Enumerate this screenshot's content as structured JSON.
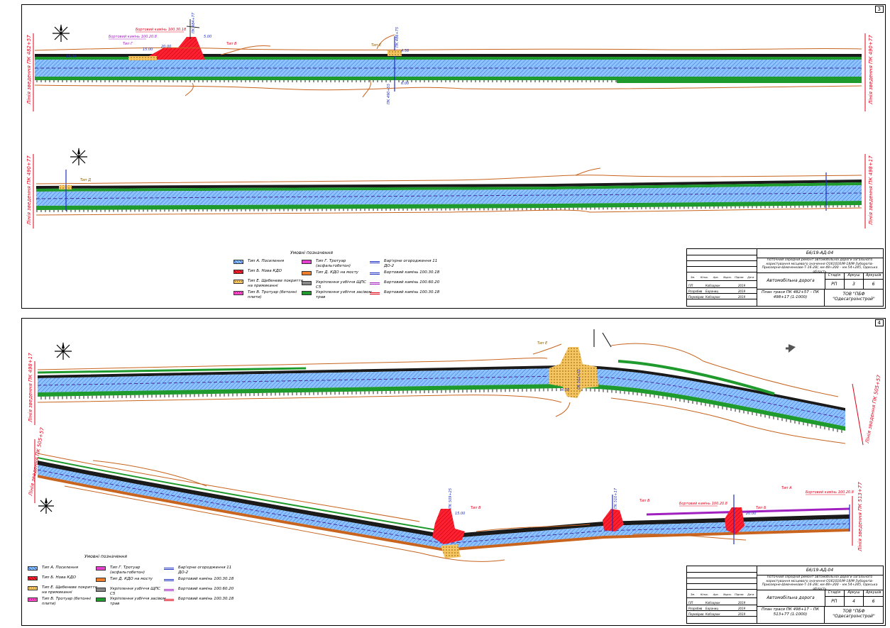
{
  "sheets": [
    {
      "sheet_no": "3",
      "match_lines": [
        "Лінія зведення ПК 482+57",
        "Лінія зведення ПК 490+77",
        "Лінія зведення ПК 490+77",
        "Лінія зведення ПК 498+17"
      ],
      "callouts": [
        "Бортовий камінь 100.30.18",
        "Бортовий камінь 100.20.8",
        "Тип Г",
        "Тип В",
        "Тип Е",
        "Тип Д",
        "15.00",
        "20.00",
        "5.00",
        "4.58",
        "15.00",
        "6.00",
        "ПК 484+77",
        "ПК 486+75",
        "ПК 490+55"
      ],
      "legend": {
        "title": "Умовні позначення",
        "items": [
          {
            "label": "Тип А. Посилення",
            "color": "#5aa9ff",
            "kind": "hatch"
          },
          {
            "label": "Тип Б. Нова КДО",
            "color": "#e0001a",
            "kind": "hatch"
          },
          {
            "label": "Тип Е. Щебеневе покриття на примиканні",
            "color": "#f0b441",
            "kind": "dots"
          },
          {
            "label": "Тип В. Тротуар (бетонні плити)",
            "color": "#ff48c8",
            "kind": "dots"
          },
          {
            "label": "Тип Г. Тротуар (асфальтобетон)",
            "color": "#e63fd0",
            "kind": "solid"
          },
          {
            "label": "Тип Д. КДО на мосту",
            "color": "#f07d2a",
            "kind": "solid"
          },
          {
            "label": "Укріплення узбіччя ЩПС С5",
            "color": "#888888",
            "kind": "solid"
          },
          {
            "label": "Укріплення узбіччя засівом трав",
            "color": "#1f9a2c",
            "kind": "solid"
          },
          {
            "label": "Бар'єрне огородження 11 ДО-2",
            "color": "#1e2fc4",
            "kind": "barrier"
          },
          {
            "label": "Бортовий камінь 100.30.18",
            "color": "#1e2fc4",
            "kind": "line"
          },
          {
            "label": "Бортовий камінь 100.60.20",
            "color": "#a020c0",
            "kind": "line"
          },
          {
            "label": "Бортовий камінь 100.30.18",
            "color": "#e0001a",
            "kind": "line"
          }
        ]
      },
      "title_block": {
        "code": "Б6/19-АД-04",
        "description": "Поточний середній ремонт автомобільної дороги загального користування місцевого значення О161016/М-18/М-Зуборогів-Приозерне-Шевченкове-Т-16-28/, км 48+200 – км 54+245, Одеська область",
        "object": "Автомобільна дорога",
        "stage_label": "Стадія",
        "sheet_label": "Аркуш",
        "sheets_label": "Аркушів",
        "stage": "РП",
        "sheet": "3",
        "sheets": "6",
        "plan": "План траси ПК 482+57 – ПК 498+17 (1:1000)",
        "org": "ТОВ \"ПБФ \"Одесагроінстрой\"",
        "header_cols": [
          "Зм.",
          "Кільк.",
          "Арк.",
          "№док.",
          "Підпис",
          "Дата"
        ],
        "rows": [
          {
            "role": "ГІП",
            "name": "Кобзарюк",
            "date": "2019"
          },
          {
            "role": "Розробив",
            "name": "Бараниц",
            "date": "2019"
          },
          {
            "role": "Перевірив",
            "name": "Кобзарюк",
            "date": "2019"
          }
        ]
      }
    },
    {
      "sheet_no": "4",
      "match_lines": [
        "Лінія зведення ПК 498+17",
        "Лінія зведення ПК 505+57",
        "Лінія зведення ПК 505+57",
        "Лінія зведення ПК 513+77"
      ],
      "callouts": [
        "Бортовий камінь 100.20.8",
        "Бортовий камінь 100.20.8",
        "Тип Е",
        "Тип В",
        "Тип В",
        "Тип Б",
        "Тип А",
        "4.58",
        "15.00",
        "20.00",
        "ПК 502+55",
        "ПК 509+25",
        "ПК 510+17"
      ],
      "legend": {
        "title": "Умовні позначення",
        "items": [
          {
            "label": "Тип А. Посилення",
            "color": "#5aa9ff",
            "kind": "hatch"
          },
          {
            "label": "Тип Б. Нова КДО",
            "color": "#e0001a",
            "kind": "hatch"
          },
          {
            "label": "Тип Е. Щебеневе покриття на примиканні",
            "color": "#f0b441",
            "kind": "dots"
          },
          {
            "label": "Тип В. Тротуар (бетонні плити)",
            "color": "#ff48c8",
            "kind": "dots"
          },
          {
            "label": "Тип Г. Тротуар (асфальтобетон)",
            "color": "#e63fd0",
            "kind": "solid"
          },
          {
            "label": "Тип Д. КДО на мосту",
            "color": "#f07d2a",
            "kind": "solid"
          },
          {
            "label": "Укріплення узбіччя ЩПС С5",
            "color": "#888888",
            "kind": "solid"
          },
          {
            "label": "Укріплення узбіччя засівом трав",
            "color": "#1f9a2c",
            "kind": "solid"
          },
          {
            "label": "Бар'єрне огородження 11 ДО-2",
            "color": "#1e2fc4",
            "kind": "barrier"
          },
          {
            "label": "Бортовий камінь 100.30.18",
            "color": "#1e2fc4",
            "kind": "line"
          },
          {
            "label": "Бортовий камінь 100.60.20",
            "color": "#a020c0",
            "kind": "line"
          },
          {
            "label": "Бортовий камінь 100.30.18",
            "color": "#e0001a",
            "kind": "line"
          }
        ]
      },
      "title_block": {
        "code": "Б6/19-АД-04",
        "description": "Поточний середній ремонт автомобільної дороги загального користування місцевого значення О161016/М-18/М-Зуборогів-Приозерне-Шевченкове-Т-16-28/, км 48+200 – км 54+245, Одеська область",
        "object": "Автомобільна дорога",
        "stage_label": "Стадія",
        "sheet_label": "Аркуш",
        "sheets_label": "Аркушів",
        "stage": "РП",
        "sheet": "4",
        "sheets": "6",
        "plan": "План траси ПК 498+17 – ПК 513+77 (1:1000)",
        "org": "ТОВ \"ПБФ \"Одесагроінстрой\"",
        "header_cols": [
          "Зм.",
          "Кільк.",
          "Арк.",
          "№док.",
          "Підпис",
          "Дата"
        ],
        "rows": [
          {
            "role": "ГІП",
            "name": "Кобзарюк",
            "date": "2019"
          },
          {
            "role": "Розробив",
            "name": "Бараниц",
            "date": "2019"
          },
          {
            "role": "Перевірив",
            "name": "Кобзарюк",
            "date": "2019"
          }
        ]
      }
    }
  ]
}
